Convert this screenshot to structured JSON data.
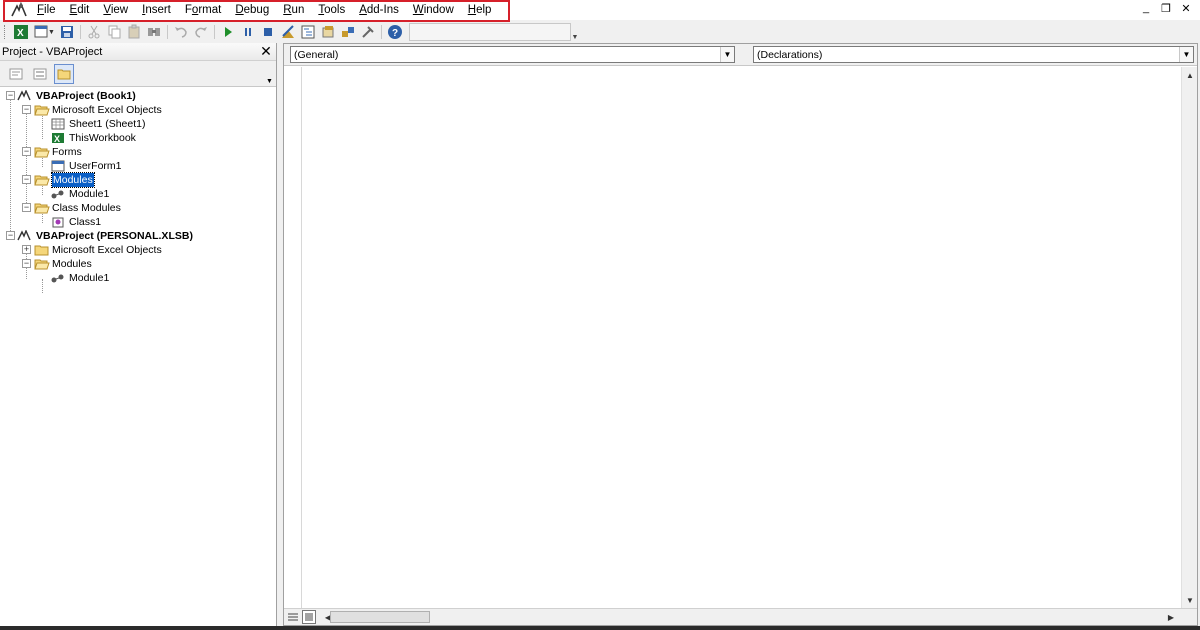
{
  "menubar": {
    "items": [
      {
        "label": "File",
        "accel": "F"
      },
      {
        "label": "Edit",
        "accel": "E"
      },
      {
        "label": "View",
        "accel": "V"
      },
      {
        "label": "Insert",
        "accel": "I"
      },
      {
        "label": "Format",
        "accel": "o"
      },
      {
        "label": "Debug",
        "accel": "D"
      },
      {
        "label": "Run",
        "accel": "R"
      },
      {
        "label": "Tools",
        "accel": "T"
      },
      {
        "label": "Add-Ins",
        "accel": "A"
      },
      {
        "label": "Window",
        "accel": "W"
      },
      {
        "label": "Help",
        "accel": "H"
      }
    ],
    "window_controls": {
      "minimize": "_",
      "restore": "❐",
      "close": "✕"
    }
  },
  "project_explorer": {
    "title": "Project - VBAProject",
    "tree": [
      {
        "label": "VBAProject (Book1)",
        "icon": "vbaproject-icon"
      },
      {
        "label": "Microsoft Excel Objects",
        "icon": "folder-icon"
      },
      {
        "label": "Sheet1 (Sheet1)",
        "icon": "worksheet-icon"
      },
      {
        "label": "ThisWorkbook",
        "icon": "workbook-icon"
      },
      {
        "label": "Forms",
        "icon": "folder-icon"
      },
      {
        "label": "UserForm1",
        "icon": "userform-icon"
      },
      {
        "label": "Modules",
        "icon": "folder-icon"
      },
      {
        "label": "Module1",
        "icon": "module-icon"
      },
      {
        "label": "Class Modules",
        "icon": "folder-icon"
      },
      {
        "label": "Class1",
        "icon": "class-icon"
      },
      {
        "label": "VBAProject (PERSONAL.XLSB)",
        "icon": "vbaproject-icon"
      },
      {
        "label": "Microsoft Excel Objects",
        "icon": "folder-icon"
      },
      {
        "label": "Modules",
        "icon": "folder-icon"
      },
      {
        "label": "Module1",
        "icon": "module-icon"
      }
    ]
  },
  "code_window": {
    "object_combo": "(General)",
    "procedure_combo": "(Declarations)"
  },
  "colors": {
    "selection": "#0b5fc6",
    "highlight_box": "#d6202a"
  }
}
